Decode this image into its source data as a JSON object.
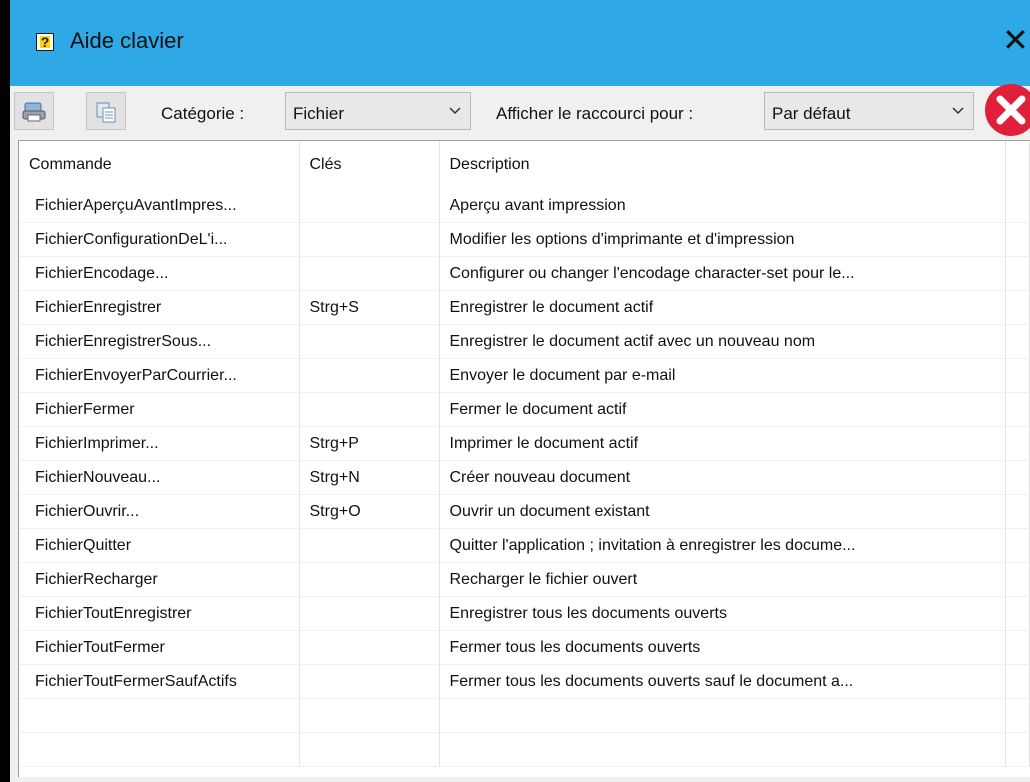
{
  "window": {
    "title": "Aide clavier",
    "close_glyph": "✕"
  },
  "toolbar": {
    "print_button_icon": "printer-icon",
    "copy_button_icon": "copy-icon",
    "category_label": "Catégorie :",
    "category_value": "Fichier",
    "shortcut_label": "Afficher le raccourci pour :",
    "shortcut_value": "Par défaut",
    "close_icon": "stop-close-icon"
  },
  "table": {
    "headers": [
      "Commande",
      "Clés",
      "Description"
    ],
    "rows": [
      {
        "command": "FichierAperçuAvantImpres...",
        "keys": "",
        "description": "Aperçu avant impression"
      },
      {
        "command": "FichierConfigurationDeL'i...",
        "keys": "",
        "description": "Modifier les options d'imprimante et d'impression"
      },
      {
        "command": "FichierEncodage...",
        "keys": "",
        "description": "Configurer ou changer l'encodage character-set pour le..."
      },
      {
        "command": "FichierEnregistrer",
        "keys": "Strg+S",
        "description": "Enregistrer le document actif"
      },
      {
        "command": "FichierEnregistrerSous...",
        "keys": "",
        "description": "Enregistrer le document actif avec un nouveau nom"
      },
      {
        "command": "FichierEnvoyerParCourrier...",
        "keys": "",
        "description": "Envoyer le document par e-mail"
      },
      {
        "command": "FichierFermer",
        "keys": "",
        "description": "Fermer le document actif"
      },
      {
        "command": "FichierImprimer...",
        "keys": "Strg+P",
        "description": "Imprimer le document actif"
      },
      {
        "command": "FichierNouveau...",
        "keys": "Strg+N",
        "description": "Créer nouveau document"
      },
      {
        "command": "FichierOuvrir...",
        "keys": "Strg+O",
        "description": "Ouvrir un document existant"
      },
      {
        "command": "FichierQuitter",
        "keys": "",
        "description": "Quitter l'application ; invitation à enregistrer les docume..."
      },
      {
        "command": "FichierRecharger",
        "keys": "",
        "description": "Recharger le fichier ouvert"
      },
      {
        "command": "FichierToutEnregistrer",
        "keys": "",
        "description": "Enregistrer tous les documents ouverts"
      },
      {
        "command": "FichierToutFermer",
        "keys": "",
        "description": "Fermer tous les documents ouverts"
      },
      {
        "command": "FichierToutFermerSaufActifs",
        "keys": "",
        "description": "Fermer tous les documents ouverts sauf le document a..."
      },
      {
        "command": "",
        "keys": "",
        "description": ""
      },
      {
        "command": "",
        "keys": "",
        "description": ""
      }
    ]
  },
  "colors": {
    "titlebar": "#2ea9e6",
    "window_bg": "#f0f0f0",
    "close_red": "#e0203a"
  }
}
